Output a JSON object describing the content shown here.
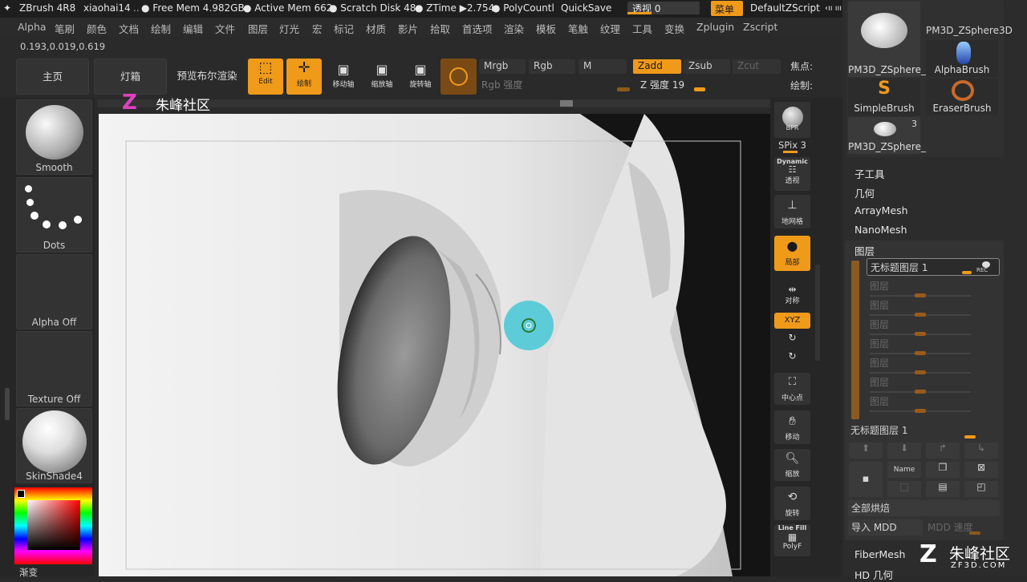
{
  "topbar": {
    "app": "ZBrush 4R8",
    "user": "xiaohai14",
    "free_mem": "● Free Mem 4.982GB",
    "active_mem": "● Active Mem 662",
    "scratch": "● Scratch Disk 48",
    "ztime": "● ZTime ▶2.754",
    "polycount": "● PolyCountl",
    "quicksave": "QuickSave",
    "transparency": "透视 0",
    "menu_btn": "菜单",
    "script": "DefaultZScript"
  },
  "menubar": [
    "Alpha",
    "笔刷",
    "颜色",
    "文档",
    "绘制",
    "编辑",
    "文件",
    "图层",
    "灯光",
    "宏",
    "标记",
    "材质",
    "影片",
    "拾取",
    "首选项",
    "渲染",
    "模板",
    "笔触",
    "纹理",
    "工具",
    "变换",
    "Zplugin",
    "Zscript"
  ],
  "coords": "0.193,0.019,0.619",
  "toolbar": {
    "home": "主页",
    "lightbox": "灯箱",
    "bpr_preview": "预览布尔渲染",
    "edit": "Edit",
    "draw": "绘制",
    "move": "移动轴",
    "scale": "缩放轴",
    "rotate": "旋转轴",
    "mrgb": "Mrgb",
    "rgb": "Rgb",
    "m": "M",
    "zadd": "Zadd",
    "zsub": "Zsub",
    "zcut": "Zcut",
    "focal": "焦点:",
    "rgb_intensity": "Rgb 强度",
    "z_intensity": "Z 强度 19",
    "draw_size": "绘制:"
  },
  "left_shelf": {
    "brush": "Smooth",
    "stroke": "Dots",
    "alpha": "Alpha Off",
    "texture": "Texture Off",
    "material": "SkinShade4",
    "gradient": "渐变"
  },
  "watermark": "朱峰社区",
  "watermark2": "ZF3D.COM",
  "right_shelf": {
    "bpr": "BPR",
    "spix": "SPix 3",
    "dynamic": "Dynamic",
    "persp": "透视",
    "floor": "地网格",
    "local": "局部",
    "sym": "对称",
    "xyz": "XYZ",
    "center": "中心点",
    "move": "移动",
    "zoom": "缩放",
    "rotate": "旋转",
    "linefill": "Line Fill",
    "polyf": "PolyF"
  },
  "tool_panel": {
    "thumbs": [
      "PM3D_ZSphere_",
      "AlphaBrush",
      "SimpleBrush",
      "EraserBrush",
      "PM3D_ZSphere_"
    ],
    "top_right": "PM3D_ZSphere3D",
    "badge": "3",
    "subtool": "子工具",
    "geometry": "几何",
    "arraymesh": "ArrayMesh",
    "nanomesh": "NanoMesh",
    "layers": "图层",
    "layer_name": "无标题图层 1",
    "rec": "REC",
    "empty_layer": "图层",
    "layer_name2": "无标题图层 1",
    "name_btn": "Name",
    "bake_all": "全部烘焙",
    "import_mdd": "导入 MDD",
    "mdd_speed": "MDD 速度",
    "fibermesh": "FiberMesh",
    "hd_geometry": "HD 几何"
  },
  "colors": {
    "accent": "#f09a1a",
    "cursor": "#45c8d6"
  }
}
